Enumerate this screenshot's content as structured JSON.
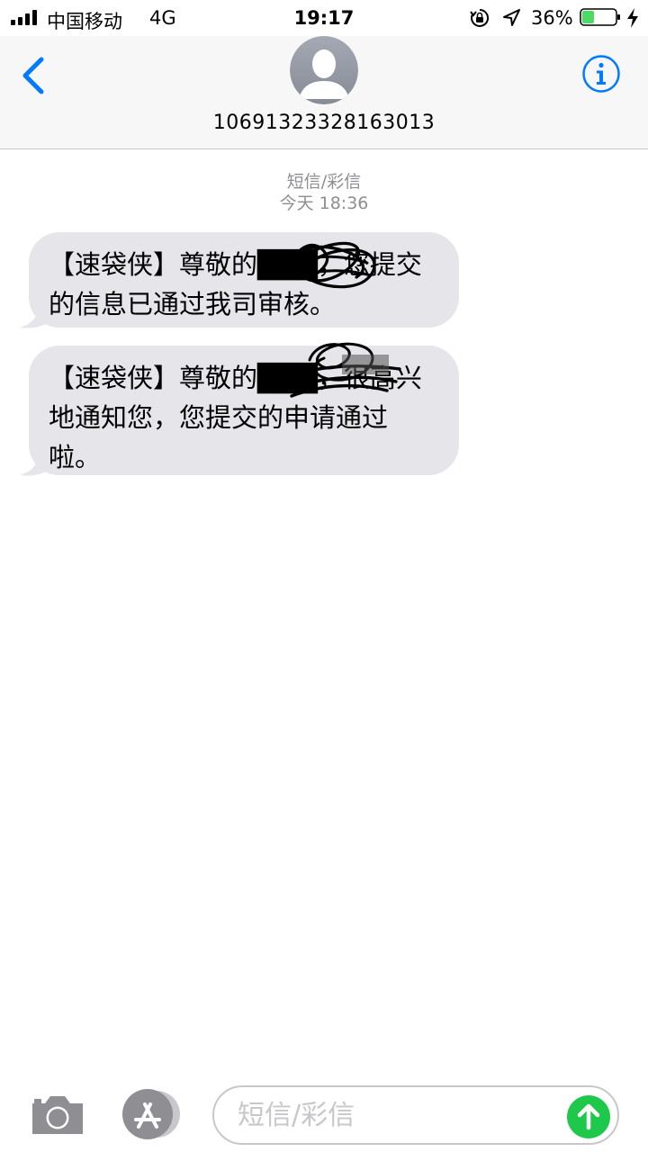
{
  "status_bar": {
    "carrier": "中国移动",
    "network": "4G",
    "time": "19:17",
    "battery_percent": "36%",
    "battery_level": 0.36,
    "icons": [
      "signal-icon",
      "orientation-lock-icon",
      "location-icon",
      "battery-icon",
      "charging-bolt-icon"
    ]
  },
  "header": {
    "back_icon": "chevron-left-icon",
    "avatar_icon": "person-silhouette-icon",
    "contact": "10691323328163013",
    "info_icon": "info-icon"
  },
  "conversation": {
    "service_label": "短信/彩信",
    "timestamp": "今天 18:36",
    "messages": [
      {
        "text": "【速袋侠】尊敬的███，您提交的信息已通过我司审核。",
        "redacted": true
      },
      {
        "text": "【速袋侠】尊敬的███，很高兴地通知您，您提交的申请通过啦。",
        "redacted": true
      }
    ]
  },
  "compose": {
    "placeholder": "短信/彩信",
    "camera_icon": "camera-icon",
    "appstore_icon": "app-store-icon",
    "send_icon": "send-arrow-icon"
  },
  "colors": {
    "accent": "#007aff",
    "bubble": "#e5e5ea",
    "send": "#1ec84b",
    "battery_fill": "#4cd964",
    "meta_text": "#8e8e93"
  }
}
